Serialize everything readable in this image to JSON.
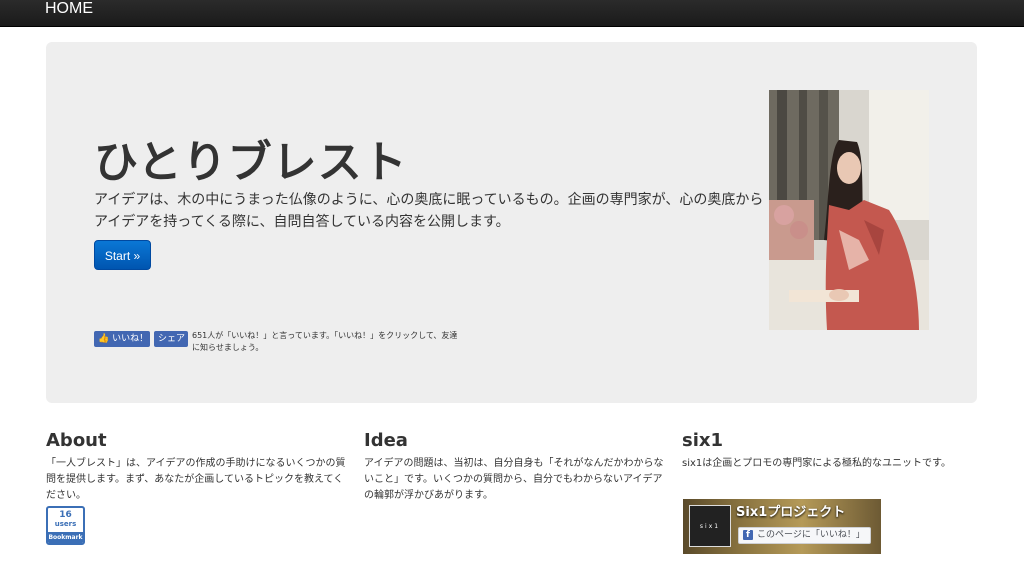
{
  "navbar": {
    "brand": "HOME"
  },
  "hero": {
    "title": "ひとりブレスト",
    "description": "アイデアは、木の中にうまった仏像のように、心の奥底に眠っているもの。企画の専門家が、心の奥底からアイデアを持ってくる際に、自問自答している内容を公開します。",
    "start_label": "Start »",
    "fb": {
      "like_label": "いいね！",
      "share_label": "シェア",
      "count_text": "651人が「いいね！」と言っています。「いいね！」をクリックして、友達に知らせましょう。"
    }
  },
  "columns": [
    {
      "heading": "About",
      "text": "「一人ブレスト」は、アイデアの作成の手助けになるいくつかの質問を提供します。まず、あなたが企画しているトピックを教えてください。"
    },
    {
      "heading": "Idea",
      "text": "アイデアの問題は、当初は、自分自身も「それがなんだかわからないこと」です。いくつかの質問から、自分でもわからないアイデアの輪郭が浮かびあがります。"
    },
    {
      "heading": "six1",
      "text": "six1は企画とプロモの専門家による極私的なユニットです。"
    }
  ],
  "bookmark": {
    "count": "16",
    "unit": "users",
    "label": "Bookmark"
  },
  "fb_page": {
    "thumb_text": "six1",
    "name": "Six1プロジェクト",
    "like_label": "このページに「いいね！」"
  }
}
